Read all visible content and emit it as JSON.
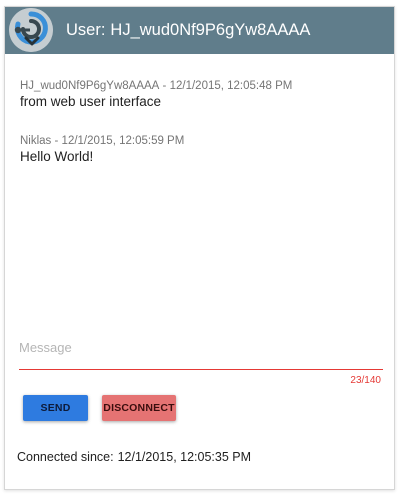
{
  "header": {
    "prefix": "User:",
    "username": "HJ_wud0Nf9P6gYw8AAAA",
    "logo_icon": "chat-logo-icon",
    "background_color": "#607d8b"
  },
  "messages": [
    {
      "author": "HJ_wud0Nf9P6gYw8AAAA",
      "timestamp": "12/1/2015, 12:05:48 PM",
      "text": "from web user interface"
    },
    {
      "author": "Niklas",
      "timestamp": "12/1/2015, 12:05:59 PM",
      "text": "Hello World!"
    }
  ],
  "composer": {
    "value": "",
    "placeholder": "Message",
    "char_count": "23/140",
    "error_color": "#e53935"
  },
  "buttons": {
    "send_label": "SEND",
    "send_color": "#2e7be0",
    "disconnect_label": "DISCONNECT",
    "disconnect_color": "#e57373"
  },
  "status": {
    "label": "Connected since:",
    "value": "12/1/2015, 12:05:35 PM"
  }
}
